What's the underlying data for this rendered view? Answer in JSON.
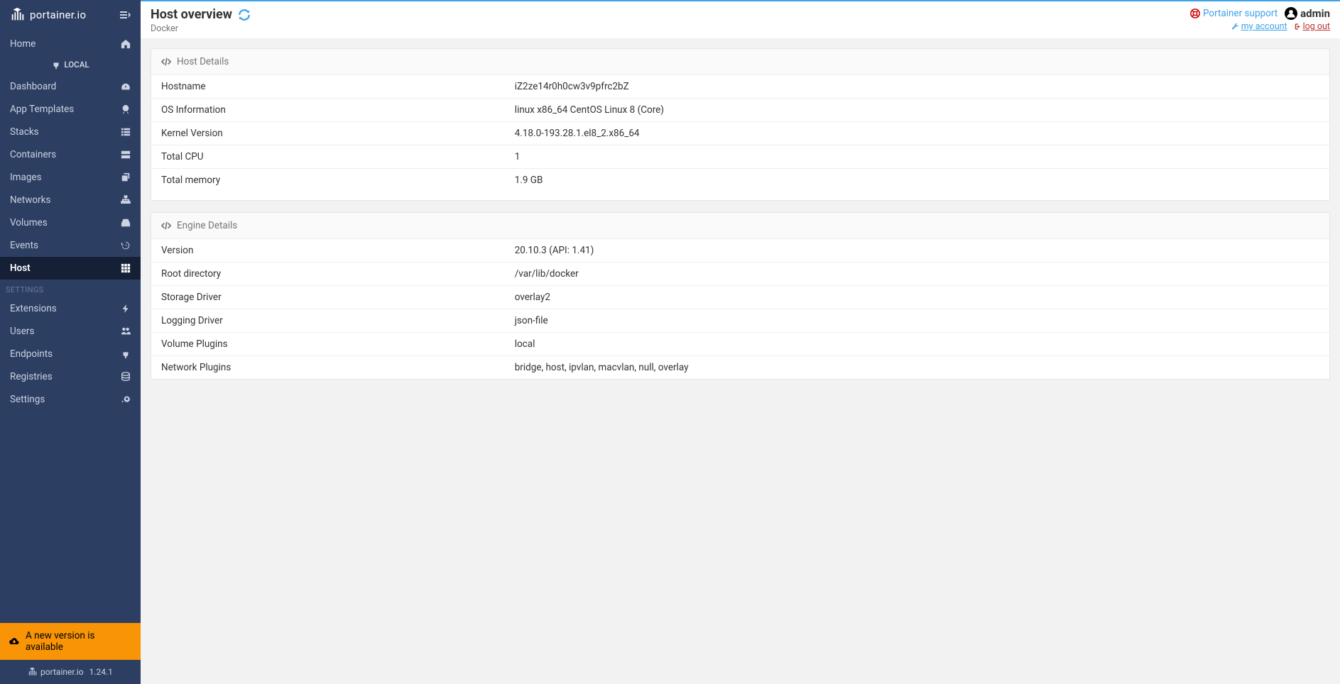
{
  "brand": "portainer.io",
  "sidebar": {
    "endpoint_label": "LOCAL",
    "items": [
      {
        "label": "Home",
        "icon": "home"
      },
      {
        "label": "Dashboard",
        "icon": "tachometer"
      },
      {
        "label": "App Templates",
        "icon": "rocket"
      },
      {
        "label": "Stacks",
        "icon": "th-list"
      },
      {
        "label": "Containers",
        "icon": "server"
      },
      {
        "label": "Images",
        "icon": "clone"
      },
      {
        "label": "Networks",
        "icon": "sitemap"
      },
      {
        "label": "Volumes",
        "icon": "hdd"
      },
      {
        "label": "Events",
        "icon": "history"
      },
      {
        "label": "Host",
        "icon": "th"
      }
    ],
    "settings_label": "SETTINGS",
    "settings_items": [
      {
        "label": "Extensions",
        "icon": "bolt"
      },
      {
        "label": "Users",
        "icon": "users"
      },
      {
        "label": "Endpoints",
        "icon": "plug"
      },
      {
        "label": "Registries",
        "icon": "database"
      },
      {
        "label": "Settings",
        "icon": "cogs"
      }
    ],
    "update_banner": "A new version is available",
    "footer_brand": "portainer.io",
    "version": "1.24.1"
  },
  "header": {
    "title": "Host overview",
    "subtitle": "Docker",
    "support": "Portainer support",
    "user": "admin",
    "my_account": "my account",
    "logout": "log out"
  },
  "host_details": {
    "title": "Host Details",
    "rows": [
      {
        "k": "Hostname",
        "v": "iZ2ze14r0h0cw3v9pfrc2bZ"
      },
      {
        "k": "OS Information",
        "v": "linux x86_64 CentOS Linux 8 (Core)"
      },
      {
        "k": "Kernel Version",
        "v": "4.18.0-193.28.1.el8_2.x86_64"
      },
      {
        "k": "Total CPU",
        "v": "1"
      },
      {
        "k": "Total memory",
        "v": "1.9 GB"
      }
    ]
  },
  "engine_details": {
    "title": "Engine Details",
    "rows": [
      {
        "k": "Version",
        "v": "20.10.3 (API: 1.41)"
      },
      {
        "k": "Root directory",
        "v": "/var/lib/docker"
      },
      {
        "k": "Storage Driver",
        "v": "overlay2"
      },
      {
        "k": "Logging Driver",
        "v": "json-file"
      },
      {
        "k": "Volume Plugins",
        "v": "local"
      },
      {
        "k": "Network Plugins",
        "v": "bridge, host, ipvlan, macvlan, null, overlay"
      }
    ]
  }
}
